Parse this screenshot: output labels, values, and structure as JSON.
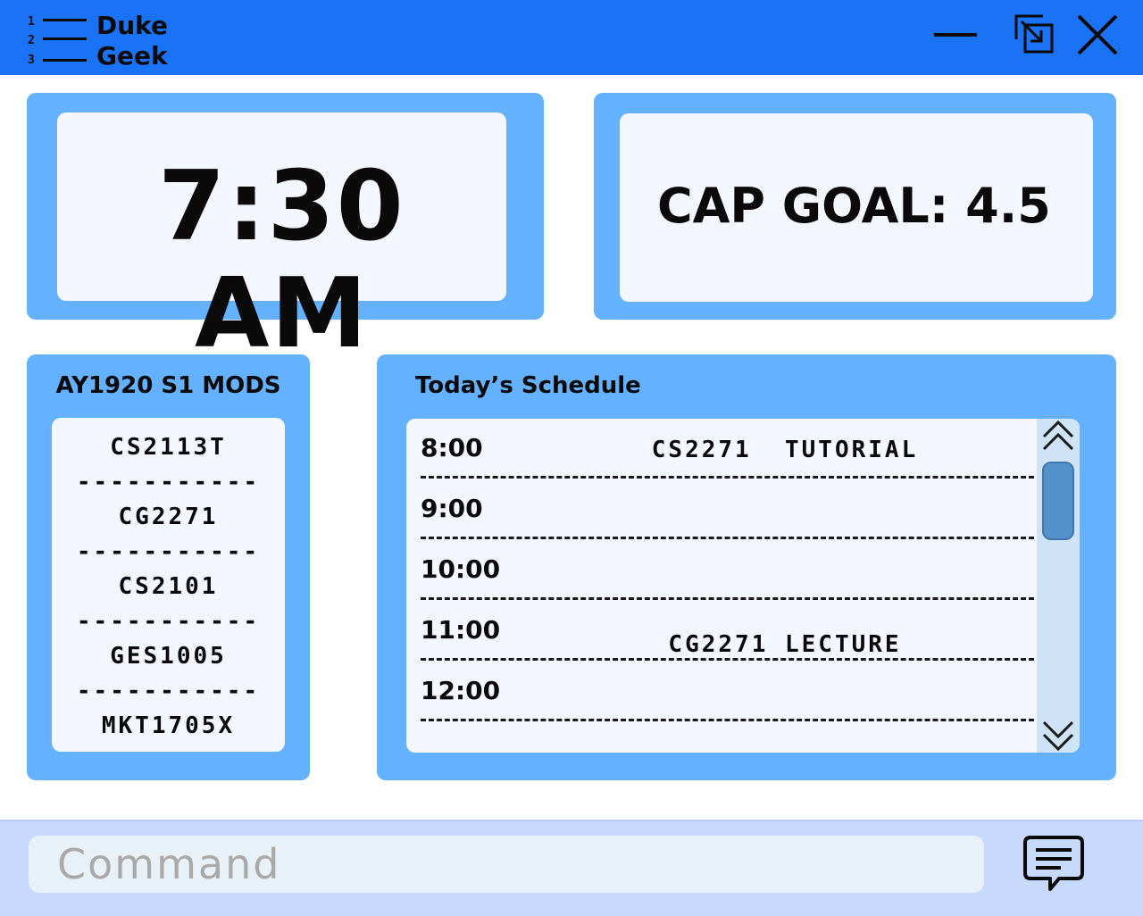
{
  "app": {
    "name_line1": "Duke",
    "name_line2": "Geek",
    "logo_digits": [
      "1",
      "2",
      "3"
    ]
  },
  "window_controls": {
    "minimize": "minimize-icon",
    "restore": "restore-icon",
    "close": "close-icon"
  },
  "clock": {
    "time": "7:30 AM"
  },
  "cap": {
    "text": "CAP GOAL: 4.5"
  },
  "mods": {
    "title": "AY1920 S1 MODS",
    "separator": "-----------",
    "items": [
      "CS2113T",
      "CG2271",
      "CS2101",
      "GES1005",
      "MKT1705X"
    ]
  },
  "schedule": {
    "title": "Today’s Schedule",
    "rows": [
      {
        "time": "8:00",
        "event": "CS2271  TUTORIAL"
      },
      {
        "time": "9:00",
        "event": ""
      },
      {
        "time": "10:00",
        "event": ""
      },
      {
        "time": "11:00",
        "event": "CG2271 LECTURE"
      },
      {
        "time": "12:00",
        "event": ""
      }
    ]
  },
  "command": {
    "placeholder": "Command",
    "value": ""
  },
  "colors": {
    "titlebar": "#1a73f5",
    "panel": "#63b1ff",
    "panel_inner": "#f4f7ff",
    "command_bar": "#c7dafb",
    "scroll_thumb": "#5591cc"
  }
}
